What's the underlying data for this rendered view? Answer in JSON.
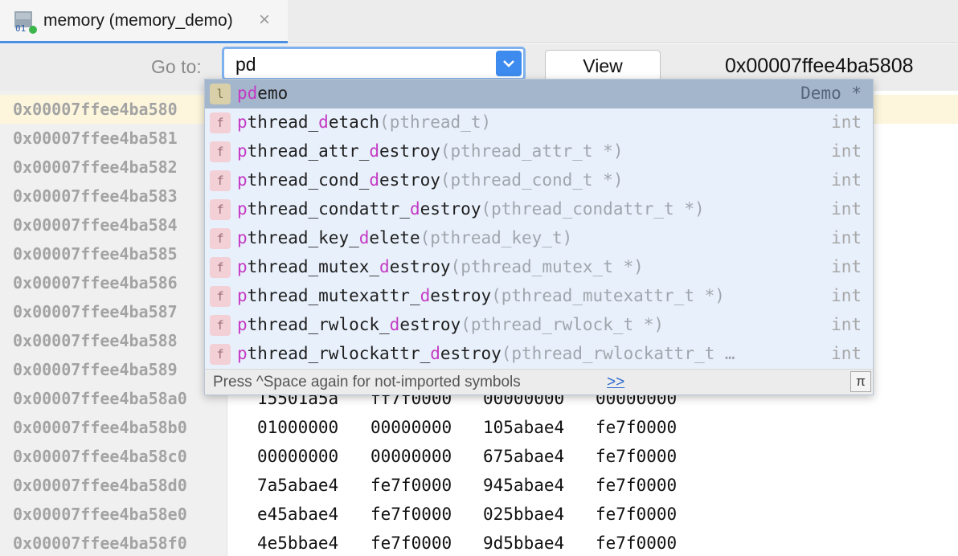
{
  "tab": {
    "title": "memory (memory_demo)",
    "icon": "memory-view-icon",
    "close_icon": "close-icon"
  },
  "toolbar": {
    "goto_label": "Go to:",
    "goto_value": "pd",
    "view_label": "View",
    "address_readout": "0x00007ffee4ba5808"
  },
  "memory": {
    "rows": [
      {
        "addr": "0x00007ffee4ba580",
        "words": [
          "",
          "",
          "",
          ""
        ]
      },
      {
        "addr": "0x00007ffee4ba581",
        "words": [
          "",
          "",
          "",
          ""
        ]
      },
      {
        "addr": "0x00007ffee4ba582",
        "words": [
          "",
          "",
          "",
          ""
        ]
      },
      {
        "addr": "0x00007ffee4ba583",
        "words": [
          "",
          "",
          "",
          ""
        ]
      },
      {
        "addr": "0x00007ffee4ba584",
        "words": [
          "",
          "",
          "",
          ""
        ]
      },
      {
        "addr": "0x00007ffee4ba585",
        "words": [
          "",
          "",
          "",
          ""
        ]
      },
      {
        "addr": "0x00007ffee4ba586",
        "words": [
          "",
          "",
          "",
          ""
        ]
      },
      {
        "addr": "0x00007ffee4ba587",
        "words": [
          "",
          "",
          "",
          ""
        ]
      },
      {
        "addr": "0x00007ffee4ba588",
        "words": [
          "",
          "",
          "",
          ""
        ]
      },
      {
        "addr": "0x00007ffee4ba589",
        "words": [
          "",
          "",
          "",
          ""
        ]
      },
      {
        "addr": "0x00007ffee4ba58a0",
        "words": [
          "15501a5a",
          "ff7f0000",
          "00000000",
          "00000000"
        ]
      },
      {
        "addr": "0x00007ffee4ba58b0",
        "words": [
          "01000000",
          "00000000",
          "105abae4",
          "fe7f0000"
        ]
      },
      {
        "addr": "0x00007ffee4ba58c0",
        "words": [
          "00000000",
          "00000000",
          "675abae4",
          "fe7f0000"
        ]
      },
      {
        "addr": "0x00007ffee4ba58d0",
        "words": [
          "7a5abae4",
          "fe7f0000",
          "945abae4",
          "fe7f0000"
        ]
      },
      {
        "addr": "0x00007ffee4ba58e0",
        "words": [
          "e45abae4",
          "fe7f0000",
          "025bbae4",
          "fe7f0000"
        ]
      },
      {
        "addr": "0x00007ffee4ba58f0",
        "words": [
          "4e5bbae4",
          "fe7f0000",
          "9d5bbae4",
          "fe7f0000"
        ]
      }
    ]
  },
  "completion": {
    "items": [
      {
        "kind": "l",
        "kind_icon": "local-variable-icon",
        "pre": "",
        "m1": "pd",
        "mid": "emo",
        "m2": "",
        "post": "",
        "sig": "",
        "rtype": "Demo *"
      },
      {
        "kind": "f",
        "kind_icon": "function-icon",
        "pre": "",
        "m1": "p",
        "mid": "thread_",
        "m2": "d",
        "post": "etach",
        "sig": "(pthread_t)",
        "rtype": "int"
      },
      {
        "kind": "f",
        "kind_icon": "function-icon",
        "pre": "",
        "m1": "p",
        "mid": "thread_attr_",
        "m2": "d",
        "post": "estroy",
        "sig": "(pthread_attr_t *)",
        "rtype": "int"
      },
      {
        "kind": "f",
        "kind_icon": "function-icon",
        "pre": "",
        "m1": "p",
        "mid": "thread_cond_",
        "m2": "d",
        "post": "estroy",
        "sig": "(pthread_cond_t *)",
        "rtype": "int"
      },
      {
        "kind": "f",
        "kind_icon": "function-icon",
        "pre": "",
        "m1": "p",
        "mid": "thread_condattr_",
        "m2": "d",
        "post": "estroy",
        "sig": "(pthread_condattr_t *)",
        "rtype": "int"
      },
      {
        "kind": "f",
        "kind_icon": "function-icon",
        "pre": "",
        "m1": "p",
        "mid": "thread_key_",
        "m2": "d",
        "post": "elete",
        "sig": "(pthread_key_t)",
        "rtype": "int"
      },
      {
        "kind": "f",
        "kind_icon": "function-icon",
        "pre": "",
        "m1": "p",
        "mid": "thread_mutex_",
        "m2": "d",
        "post": "estroy",
        "sig": "(pthread_mutex_t *)",
        "rtype": "int"
      },
      {
        "kind": "f",
        "kind_icon": "function-icon",
        "pre": "",
        "m1": "p",
        "mid": "thread_mutexattr_",
        "m2": "d",
        "post": "estroy",
        "sig": "(pthread_mutexattr_t *)",
        "rtype": "int"
      },
      {
        "kind": "f",
        "kind_icon": "function-icon",
        "pre": "",
        "m1": "p",
        "mid": "thread_rwlock_",
        "m2": "d",
        "post": "estroy",
        "sig": "(pthread_rwlock_t *)",
        "rtype": "int"
      },
      {
        "kind": "f",
        "kind_icon": "function-icon",
        "pre": "",
        "m1": "p",
        "mid": "thread_rwlockattr_",
        "m2": "d",
        "post": "estroy",
        "sig": "(pthread_rwlockattr_t …",
        "rtype": "int"
      }
    ],
    "footer_text": "Press ^Space again for not-imported symbols",
    "footer_link": ">>",
    "pi_label": "π"
  }
}
